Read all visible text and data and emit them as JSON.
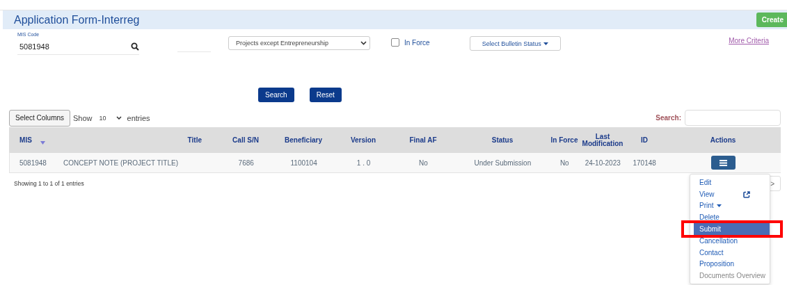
{
  "header": {
    "title": "Application Form-Interreg",
    "create_button": "Create"
  },
  "filters": {
    "mis_code": {
      "label": "MIS Code",
      "value": "5081948"
    },
    "project_type": "Projects except Entrepreneurship",
    "in_force": {
      "label": "In Force",
      "checked": false
    },
    "bulletin_status": "Select Bulletin Status",
    "more_criteria": "More Criteria"
  },
  "actions": [
    "Search",
    "Reset"
  ],
  "table_controls": {
    "select_columns": "Select Columns",
    "show": "Show",
    "page_size": "10",
    "entries": "entries",
    "search_label": "Search:"
  },
  "table": {
    "columns": [
      "MIS",
      "Title",
      "Call S/N",
      "Beneficiary",
      "Version",
      "Final AF",
      "Status",
      "In Force",
      "Last Modification",
      "ID",
      "Actions"
    ],
    "rows": [
      [
        "5081948",
        "CONCEPT NOTE (PROJECT TITLE)",
        "7686",
        "1100104",
        "1 . 0",
        "No",
        "Under Submission",
        "No",
        "24-10-2023",
        "170148"
      ]
    ]
  },
  "footer": {
    "info": "Showing 1 to 1 of 1 entries",
    "next": ">"
  },
  "action_menu": [
    {
      "label": "Edit",
      "kind": "plain",
      "selected": false,
      "disabled": false
    },
    {
      "label": "View",
      "kind": "external",
      "selected": false,
      "disabled": false
    },
    {
      "label": "Print",
      "kind": "submenu",
      "selected": false,
      "disabled": false
    },
    {
      "label": "Delete",
      "kind": "plain",
      "selected": false,
      "disabled": false
    },
    {
      "label": "Submit",
      "kind": "plain",
      "selected": true,
      "disabled": false
    },
    {
      "label": "Cancellation",
      "kind": "plain",
      "selected": false,
      "disabled": false
    },
    {
      "label": "Contact",
      "kind": "plain",
      "selected": false,
      "disabled": false
    },
    {
      "label": "Proposition",
      "kind": "plain",
      "selected": false,
      "disabled": false
    },
    {
      "label": "Documents Overview",
      "kind": "plain",
      "selected": false,
      "disabled": true
    }
  ]
}
